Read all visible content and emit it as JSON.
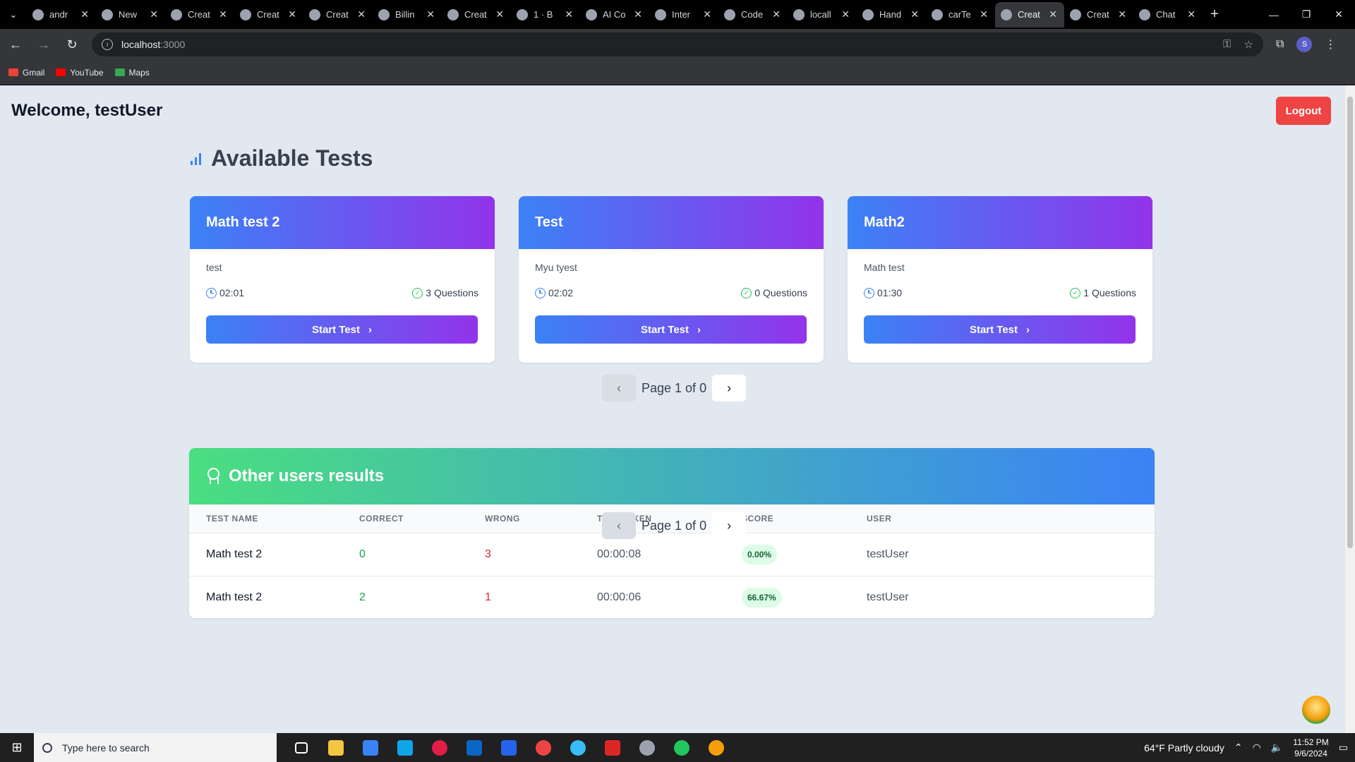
{
  "browser": {
    "tabs": [
      {
        "title": "andr"
      },
      {
        "title": "New"
      },
      {
        "title": "Creat"
      },
      {
        "title": "Creat"
      },
      {
        "title": "Creat"
      },
      {
        "title": "Billin"
      },
      {
        "title": "Creat"
      },
      {
        "title": "1 · B"
      },
      {
        "title": "AI Co"
      },
      {
        "title": "Inter"
      },
      {
        "title": "Code"
      },
      {
        "title": "locall"
      },
      {
        "title": "Hand"
      },
      {
        "title": "carTe"
      },
      {
        "title": "Creat"
      },
      {
        "title": "Creat"
      },
      {
        "title": "Chat"
      }
    ],
    "active_tab_index": 14,
    "url_host": "localhost",
    "url_port": ":3000",
    "profile_initial": "S",
    "bookmarks": [
      {
        "label": "Gmail",
        "color": "#ea4335"
      },
      {
        "label": "YouTube",
        "color": "#ff0000"
      },
      {
        "label": "Maps",
        "color": "#34a853"
      }
    ]
  },
  "header": {
    "welcome": "Welcome, testUser",
    "logout_label": "Logout"
  },
  "tests": {
    "title": "Available Tests",
    "cards": [
      {
        "name": "Math test 2",
        "description": "test",
        "duration": "02:01",
        "questions": "3 Questions",
        "button": "Start Test"
      },
      {
        "name": "Test",
        "description": "Myu tyest",
        "duration": "02:02",
        "questions": "0 Questions",
        "button": "Start Test"
      },
      {
        "name": "Math2",
        "description": "Math test",
        "duration": "01:30",
        "questions": "1 Questions",
        "button": "Start Test"
      }
    ],
    "pager_text": "Page 1 of 0"
  },
  "results": {
    "title": "Other users results",
    "columns": [
      "TEST NAME",
      "CORRECT",
      "WRONG",
      "TIME TAKEN",
      "SCORE",
      "USER"
    ],
    "rows": [
      {
        "test": "Math test 2",
        "correct": "0",
        "wrong": "3",
        "time": "00:00:08",
        "score": "0.00%",
        "user": "testUser"
      },
      {
        "test": "Math test 2",
        "correct": "2",
        "wrong": "1",
        "time": "00:00:06",
        "score": "66.67%",
        "user": "testUser"
      }
    ],
    "pager_text": "Page 1 of 0"
  },
  "taskbar": {
    "search_placeholder": "Type here to search",
    "weather": "64°F  Partly cloudy",
    "time": "11:52 PM",
    "date": "9/6/2024"
  },
  "colors": {
    "accent_blue": "#3b82f6",
    "accent_purple": "#9333ea",
    "logout_red": "#ef4444",
    "results_green": "#4ade80"
  }
}
